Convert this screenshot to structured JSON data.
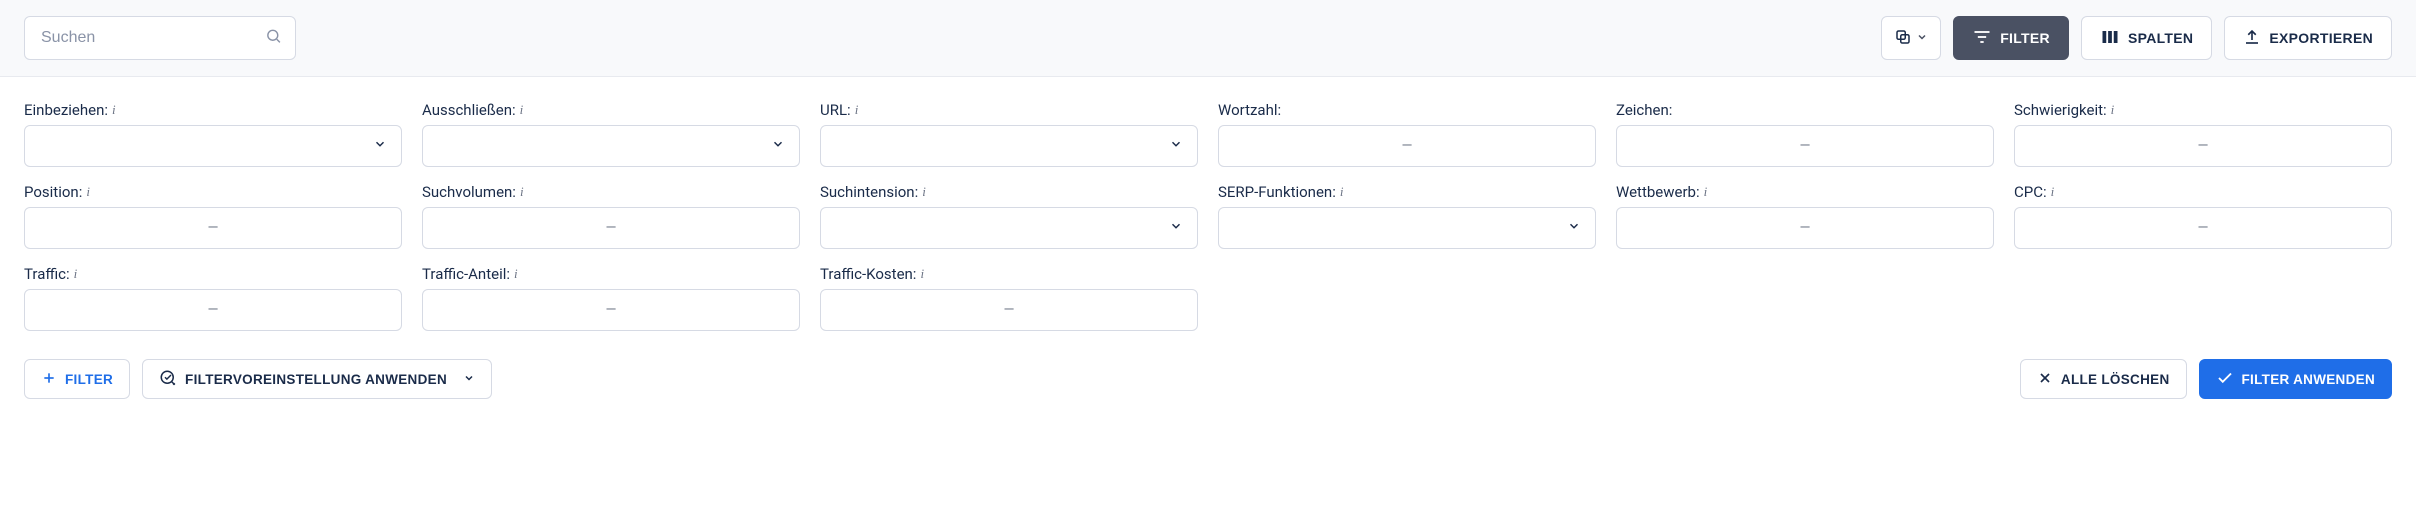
{
  "toolbar": {
    "search_placeholder": "Suchen",
    "filter_label": "FILTER",
    "columns_label": "SPALTEN",
    "export_label": "EXPORTIEREN"
  },
  "filters": {
    "row1": [
      {
        "label": "Einbeziehen:",
        "info": true,
        "type": "select"
      },
      {
        "label": "Ausschließen:",
        "info": true,
        "type": "select"
      },
      {
        "label": "URL:",
        "info": true,
        "type": "select"
      },
      {
        "label": "Wortzahl:",
        "info": false,
        "type": "range"
      },
      {
        "label": "Zeichen:",
        "info": false,
        "type": "range"
      },
      {
        "label": "Schwierigkeit:",
        "info": true,
        "type": "range"
      }
    ],
    "row2": [
      {
        "label": "Position:",
        "info": true,
        "type": "range"
      },
      {
        "label": "Suchvolumen:",
        "info": true,
        "type": "range"
      },
      {
        "label": "Suchintension:",
        "info": true,
        "type": "select"
      },
      {
        "label": "SERP-Funktionen:",
        "info": true,
        "type": "select"
      },
      {
        "label": "Wettbewerb:",
        "info": true,
        "type": "range"
      },
      {
        "label": "CPC:",
        "info": true,
        "type": "range"
      }
    ],
    "row3": [
      {
        "label": "Traffic:",
        "info": true,
        "type": "range"
      },
      {
        "label": "Traffic-Anteil:",
        "info": true,
        "type": "range"
      },
      {
        "label": "Traffic-Kosten:",
        "info": true,
        "type": "range"
      }
    ]
  },
  "range_placeholder": "—",
  "actions": {
    "add_filter": "FILTER",
    "preset": "FILTERVOREINSTELLUNG ANWENDEN",
    "clear_all": "ALLE LÖSCHEN",
    "apply": "FILTER ANWENDEN"
  }
}
